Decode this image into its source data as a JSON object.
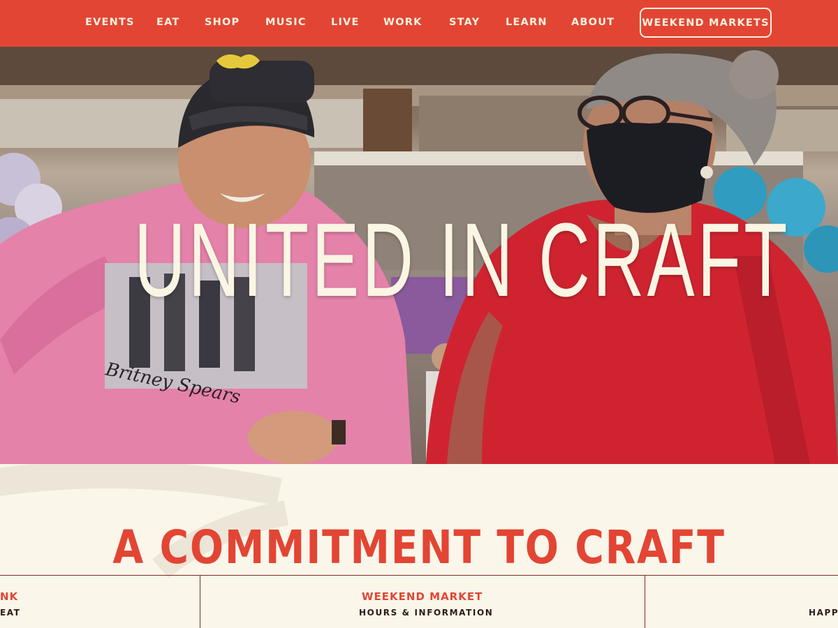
{
  "nav": {
    "items": [
      {
        "label": "EVENTS"
      },
      {
        "label": "EAT"
      },
      {
        "label": "SHOP"
      },
      {
        "label": "MUSIC"
      },
      {
        "label": "LIVE"
      },
      {
        "label": "WORK"
      },
      {
        "label": "STAY"
      },
      {
        "label": "LEARN"
      },
      {
        "label": "ABOUT"
      }
    ],
    "cta_label": "WEEKEND MARKETS"
  },
  "hero": {
    "title": "UNITED IN CRAFT",
    "shirt_text": "Britney Spears"
  },
  "section": {
    "heading": "A COMMITMENT TO CRAFT",
    "cards": [
      {
        "title": "NK",
        "subtitle": "EAT"
      },
      {
        "title": "WEEKEND MARKET",
        "subtitle": "HOURS & INFORMATION"
      },
      {
        "title": "",
        "subtitle": "HAPP"
      }
    ]
  },
  "colors": {
    "brand_red": "#e34534",
    "cream": "#faf6ea",
    "nav_text": "#fbf3df",
    "dark_text": "#2b1c18"
  }
}
